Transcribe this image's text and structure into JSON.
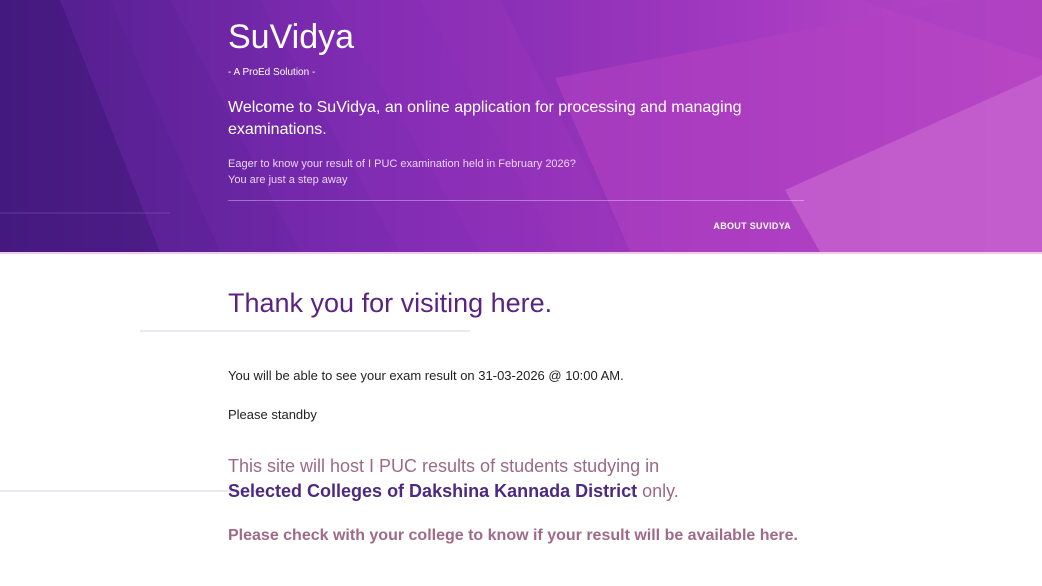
{
  "header": {
    "title": "SuVidya",
    "tagline": "- A ProEd Solution -",
    "welcome": "Welcome to SuVidya, an online application for processing and managing examinations.",
    "eager_line1": "Eager to know your result of I PUC examination held in February 2026?",
    "eager_line2": "You are just a step away",
    "about_link": "ABOUT SUVIDYA"
  },
  "main": {
    "heading": "Thank you for visiting here.",
    "result_date": "You will be able to see your exam result on 31-03-2026 @ 10:00 AM.",
    "standby": "Please standby",
    "host_prefix": "This site will host I PUC results of students studying in",
    "host_colleges": "Selected Colleges of Dakshina Kannada District",
    "host_suffix": " only.",
    "check_note": "Please check with your college to know if your result will be available here."
  },
  "colors": {
    "header_primary": "#8a2bb6",
    "header_dark": "#4c1f88",
    "header_light": "#c150c8",
    "heading": "#5b2381",
    "highlight": "#4d2a80",
    "muted_mauve": "#9b6a88"
  }
}
